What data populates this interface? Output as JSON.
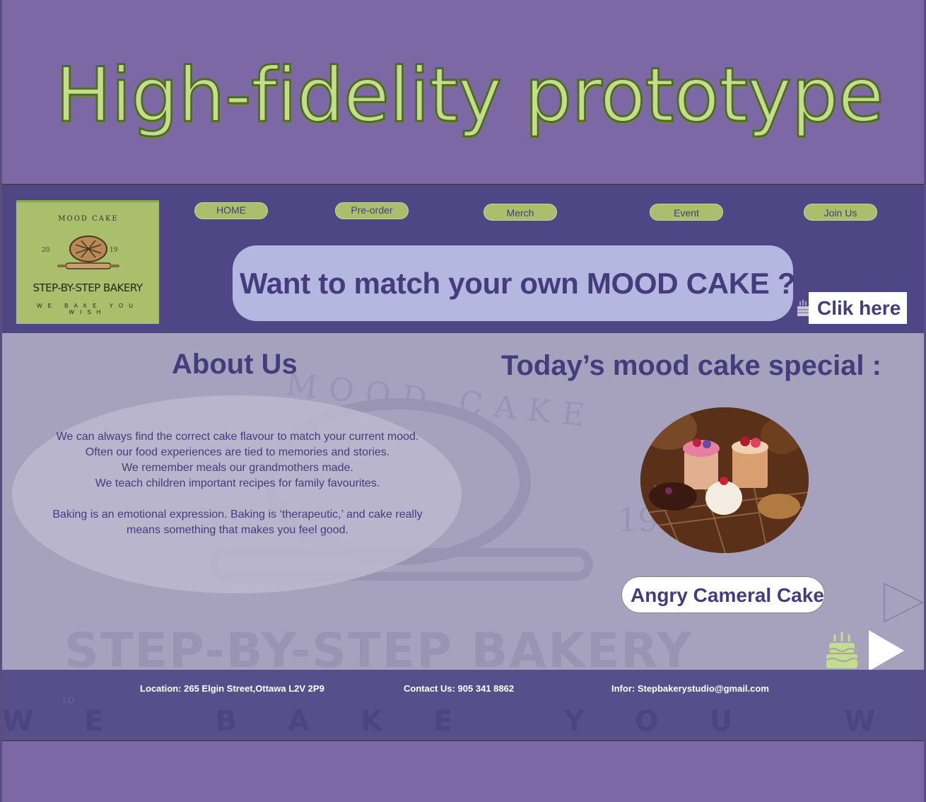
{
  "slide": {
    "title": "High-fidelity prototype"
  },
  "logo": {
    "arc_text": "MOOD CAKE",
    "year_left": "20",
    "year_right": "19",
    "brand": "STEP-BY-STEP BAKERY",
    "tagline": "WE BAKE YOU WISH"
  },
  "nav": [
    {
      "label": "HOME"
    },
    {
      "label": "Pre-order"
    },
    {
      "label": "Merch"
    },
    {
      "label": "Event"
    },
    {
      "label": "Join Us"
    }
  ],
  "hero": {
    "text": "Want to match your own MOOD CAKE ?"
  },
  "cta": {
    "label": "Clik here"
  },
  "watermark": {
    "brand": "STEP-BY-STEP BAKERY",
    "arc": "MOOD CAKE"
  },
  "about": {
    "heading": "About Us",
    "lines": [
      "We can always find the correct cake flavour to match your current mood.",
      "Often our food experiences are tied to memories and stories.",
      "We remember meals our grandmothers made.",
      "We teach children important recipes for family favourites.",
      "",
      "Baking is an emotional expression. Baking is ‘therapeutic,’ and cake really means something that makes you feel good."
    ]
  },
  "special": {
    "heading": "Today’s mood cake special :",
    "cake_name": "Angry Cameral Cake"
  },
  "footer": {
    "location": "Location: 265 Elgin Street,Ottawa L2V 2P9",
    "contact": "Contact Us: 905 341 8862",
    "info": "Infor: Stepbakerystudio@gmail.com",
    "tagline": "WE BAKE YOU WISH",
    "lo": "LO"
  },
  "icons": [
    "cake-icon",
    "bread-icon",
    "play-next-icon",
    "play-outline-icon"
  ],
  "colors": {
    "background": "#7b68a4",
    "header": "#4e4685",
    "accent_green": "#a9bf6c",
    "text_purple": "#453c7d"
  }
}
